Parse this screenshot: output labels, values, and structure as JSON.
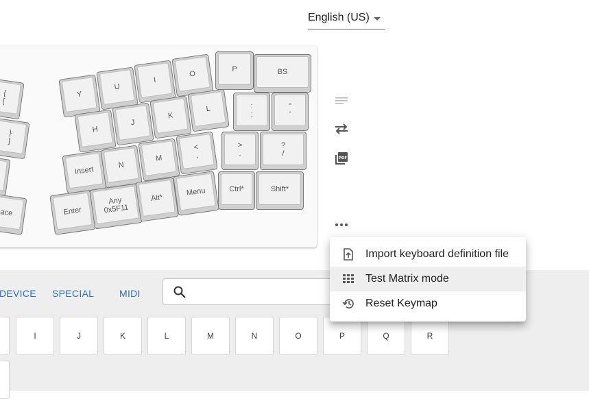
{
  "language": {
    "selected": "English (US)"
  },
  "keyboard": {
    "keys": [
      {
        "id": "brace-open",
        "top": "{",
        "bottom": "["
      },
      {
        "id": "brace-close",
        "top": "}",
        "bottom": "]"
      },
      {
        "id": "partial-left",
        "top": "",
        "bottom": ""
      },
      {
        "id": "space",
        "top": "pace",
        "bottom": ""
      },
      {
        "id": "y",
        "top": "Y",
        "bottom": ""
      },
      {
        "id": "u",
        "top": "U",
        "bottom": ""
      },
      {
        "id": "i",
        "top": "I",
        "bottom": ""
      },
      {
        "id": "o",
        "top": "O",
        "bottom": ""
      },
      {
        "id": "p",
        "top": "P",
        "bottom": ""
      },
      {
        "id": "bs",
        "top": "BS",
        "bottom": ""
      },
      {
        "id": "h",
        "top": "H",
        "bottom": ""
      },
      {
        "id": "j",
        "top": "J",
        "bottom": ""
      },
      {
        "id": "k",
        "top": "K",
        "bottom": ""
      },
      {
        "id": "l",
        "top": "L",
        "bottom": ""
      },
      {
        "id": "semicolon",
        "top": ":",
        "bottom": ";"
      },
      {
        "id": "quote",
        "top": "\"",
        "bottom": "'"
      },
      {
        "id": "insert",
        "top": "Insert",
        "bottom": ""
      },
      {
        "id": "n",
        "top": "N",
        "bottom": ""
      },
      {
        "id": "m",
        "top": "M",
        "bottom": ""
      },
      {
        "id": "comma",
        "top": "<",
        "bottom": ","
      },
      {
        "id": "period",
        "top": ">",
        "bottom": "."
      },
      {
        "id": "slash",
        "top": "?",
        "bottom": "/"
      },
      {
        "id": "enter",
        "top": "Enter",
        "bottom": ""
      },
      {
        "id": "any",
        "top": "Any",
        "bottom": "0x5F11"
      },
      {
        "id": "alt",
        "top": "Alt*",
        "bottom": ""
      },
      {
        "id": "menu",
        "top": "Menu",
        "bottom": ""
      },
      {
        "id": "ctrl",
        "top": "Ctrl*",
        "bottom": ""
      },
      {
        "id": "shift",
        "top": "Shift*",
        "bottom": ""
      }
    ]
  },
  "toolbar": {
    "icons": [
      "lines-icon",
      "swap-icon",
      "pdf-icon",
      "more-icon"
    ]
  },
  "tabs": [
    "DEVICE",
    "SPECIAL",
    "MIDI"
  ],
  "search": {
    "placeholder": ""
  },
  "keycodes": [
    "I",
    "J",
    "K",
    "L",
    "M",
    "N",
    "O",
    "P",
    "Q",
    "R"
  ],
  "menu": {
    "items": [
      {
        "label": "Import keyboard definition file",
        "icon": "file-upload-icon"
      },
      {
        "label": "Test Matrix mode",
        "icon": "grid-icon"
      },
      {
        "label": "Reset Keymap",
        "icon": "history-icon"
      }
    ],
    "selected_index": 1
  }
}
